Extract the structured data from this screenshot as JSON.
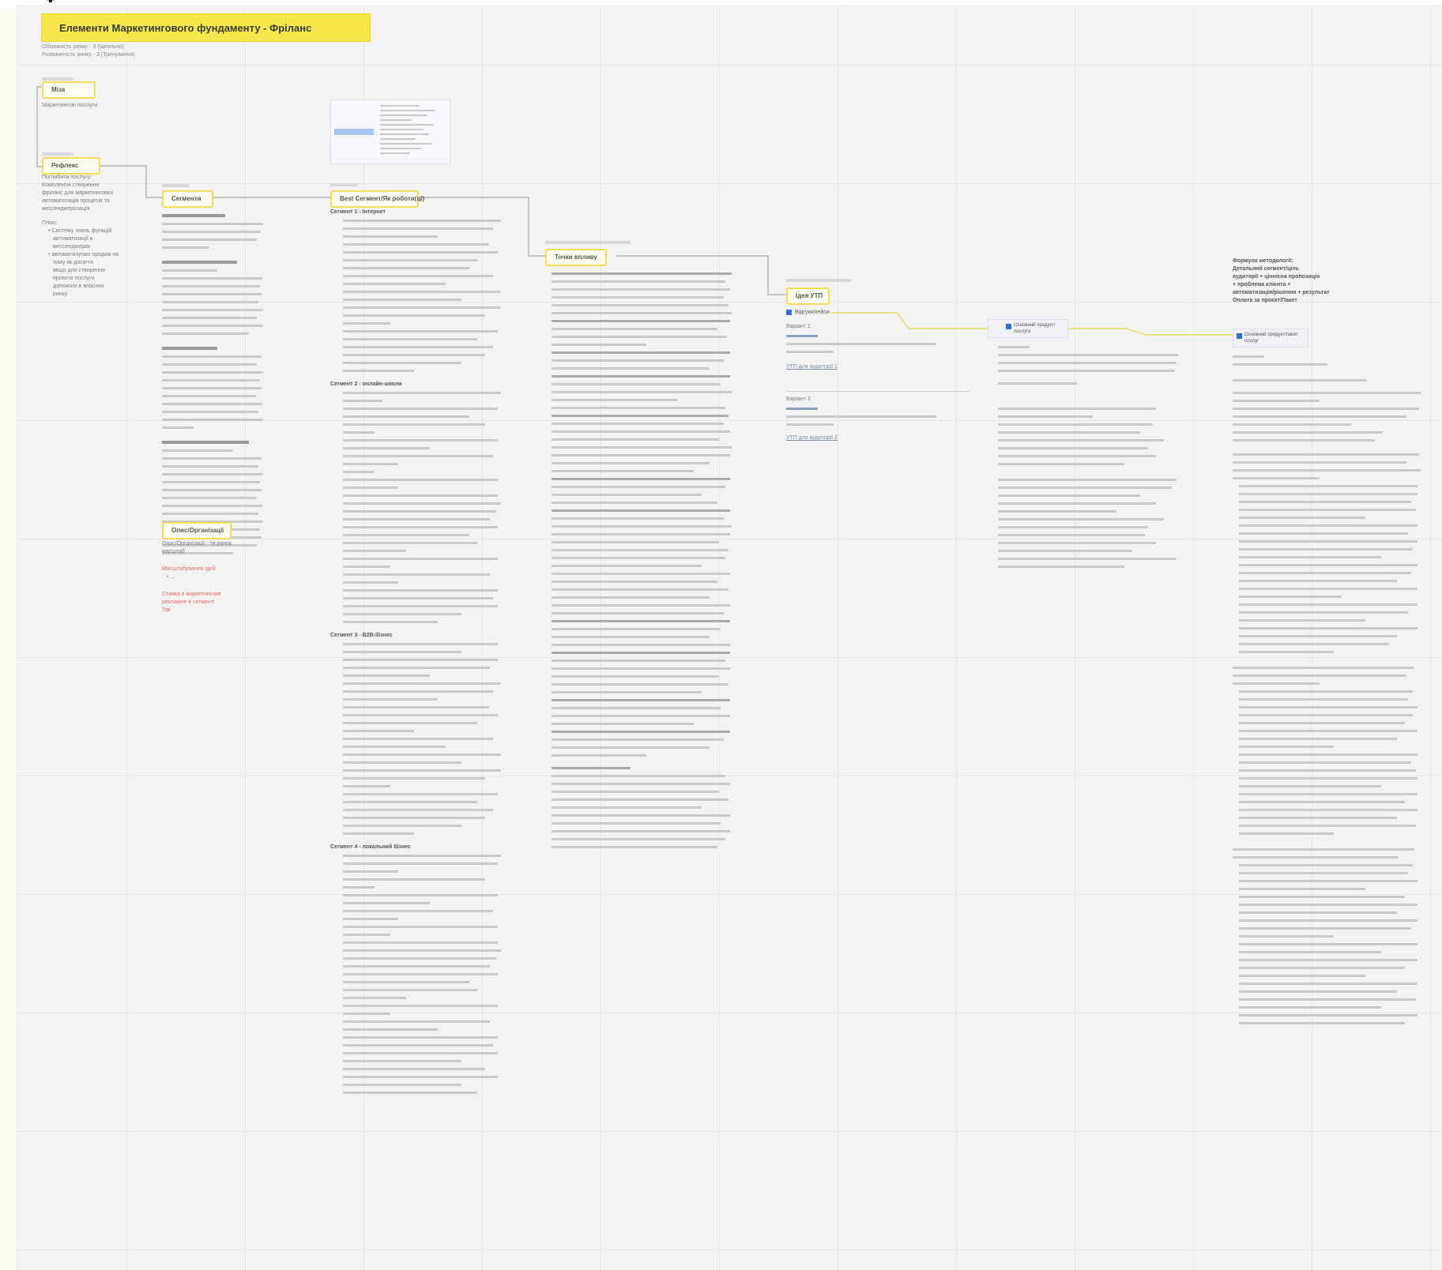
{
  "page": {
    "top_cut_title": "Ф",
    "banner": "Елементи Маркетингового фундаменту - Фріланс",
    "subtitle_lines": [
      "Обізнаність ринку - 3 (Ідеально)",
      "Розвиненість ринку - 3 (Тренування)"
    ]
  },
  "nodes": {
    "mind": {
      "label": "Міза",
      "note": "Маркетингові послуги"
    },
    "hunt": {
      "label": "Рефлекс",
      "desc": [
        "Поглибити послугу:",
        "Комплексні створення",
        "фріланс для маркетингових",
        "автоматизація процесів та",
        "мессенджеризація"
      ],
      "plus_label": "Плюс:",
      "bullets": [
        "Систему знань функцій",
        "автоматизації в",
        "мессенджерах",
        "автоматизуємо продаж на",
        "тому як досягти",
        "якщо для створення",
        "проєкти послуги",
        "допомоги в власних",
        "ринку"
      ]
    },
    "segments": {
      "label": "Сегменти"
    },
    "org": {
      "label": "Опис/Організації",
      "lines": [
        "Опис/Організації - ти ринок",
        "масштаб"
      ],
      "red_lines": [
        "Масштабування ідей",
        "• ...",
        "Ставка в маркетингове",
        "рекламне в сегменті",
        "Так"
      ]
    },
    "jobs": {
      "label": "Best Сегмент/Як роботи(ці)",
      "segment_titles": [
        "Сегмент 1 - Інтернет",
        "Сегмент 2 - онлайн-школи",
        "Сегмент 3 - B2B-бізнес",
        "Сегмент 4 - локальний бізнес"
      ]
    },
    "touch": {
      "label": "Точки впливу"
    },
    "offer": {
      "label": "Ідея УТП",
      "check_label": "Відгуки/кейси",
      "version1": "Варіант 1",
      "version2": "Варіант 2",
      "links": [
        "УТП для аудиторії 1",
        "УТП для аудиторії 2"
      ]
    },
    "product": {
      "label": "Основний продукт/послуга"
    },
    "end_product": {
      "label": "Основний продукт/пакет послуг",
      "heading": [
        "Формула методології:",
        "Детальний сегмент/ціль",
        "аудиторії + ціннісна пропозиція",
        "+ проблема клієнта +",
        "автоматизація/рішення + результат",
        "Оплата за проєкт/Пакет"
      ]
    }
  },
  "colors": {
    "banner_bg": "#f6e84a",
    "tag_border": "#f4dd55",
    "connector_yellow": "#e9dc6a",
    "connector_grey": "#b5b5b5",
    "accent_blue": "#2f6fd6"
  }
}
